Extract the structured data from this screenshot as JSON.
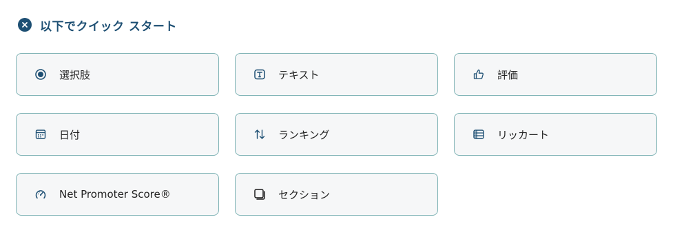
{
  "header": {
    "title": "以下でクイック スタート",
    "close_icon": "close-circle-icon",
    "accent_color": "#1d4f73"
  },
  "cards": [
    {
      "label": "選択肢",
      "icon": "radio-button-icon"
    },
    {
      "label": "テキスト",
      "icon": "text-box-icon"
    },
    {
      "label": "評価",
      "icon": "thumbs-up-icon"
    },
    {
      "label": "日付",
      "icon": "calendar-icon"
    },
    {
      "label": "ランキング",
      "icon": "sort-arrows-icon"
    },
    {
      "label": "リッカート",
      "icon": "likert-matrix-icon"
    },
    {
      "label": "Net Promoter Score®",
      "icon": "gauge-icon"
    },
    {
      "label": "セクション",
      "icon": "section-icon"
    }
  ],
  "colors": {
    "card_border": "#7fb3b5",
    "card_background": "#f6f7f8",
    "icon_color": "#1d4f73"
  }
}
